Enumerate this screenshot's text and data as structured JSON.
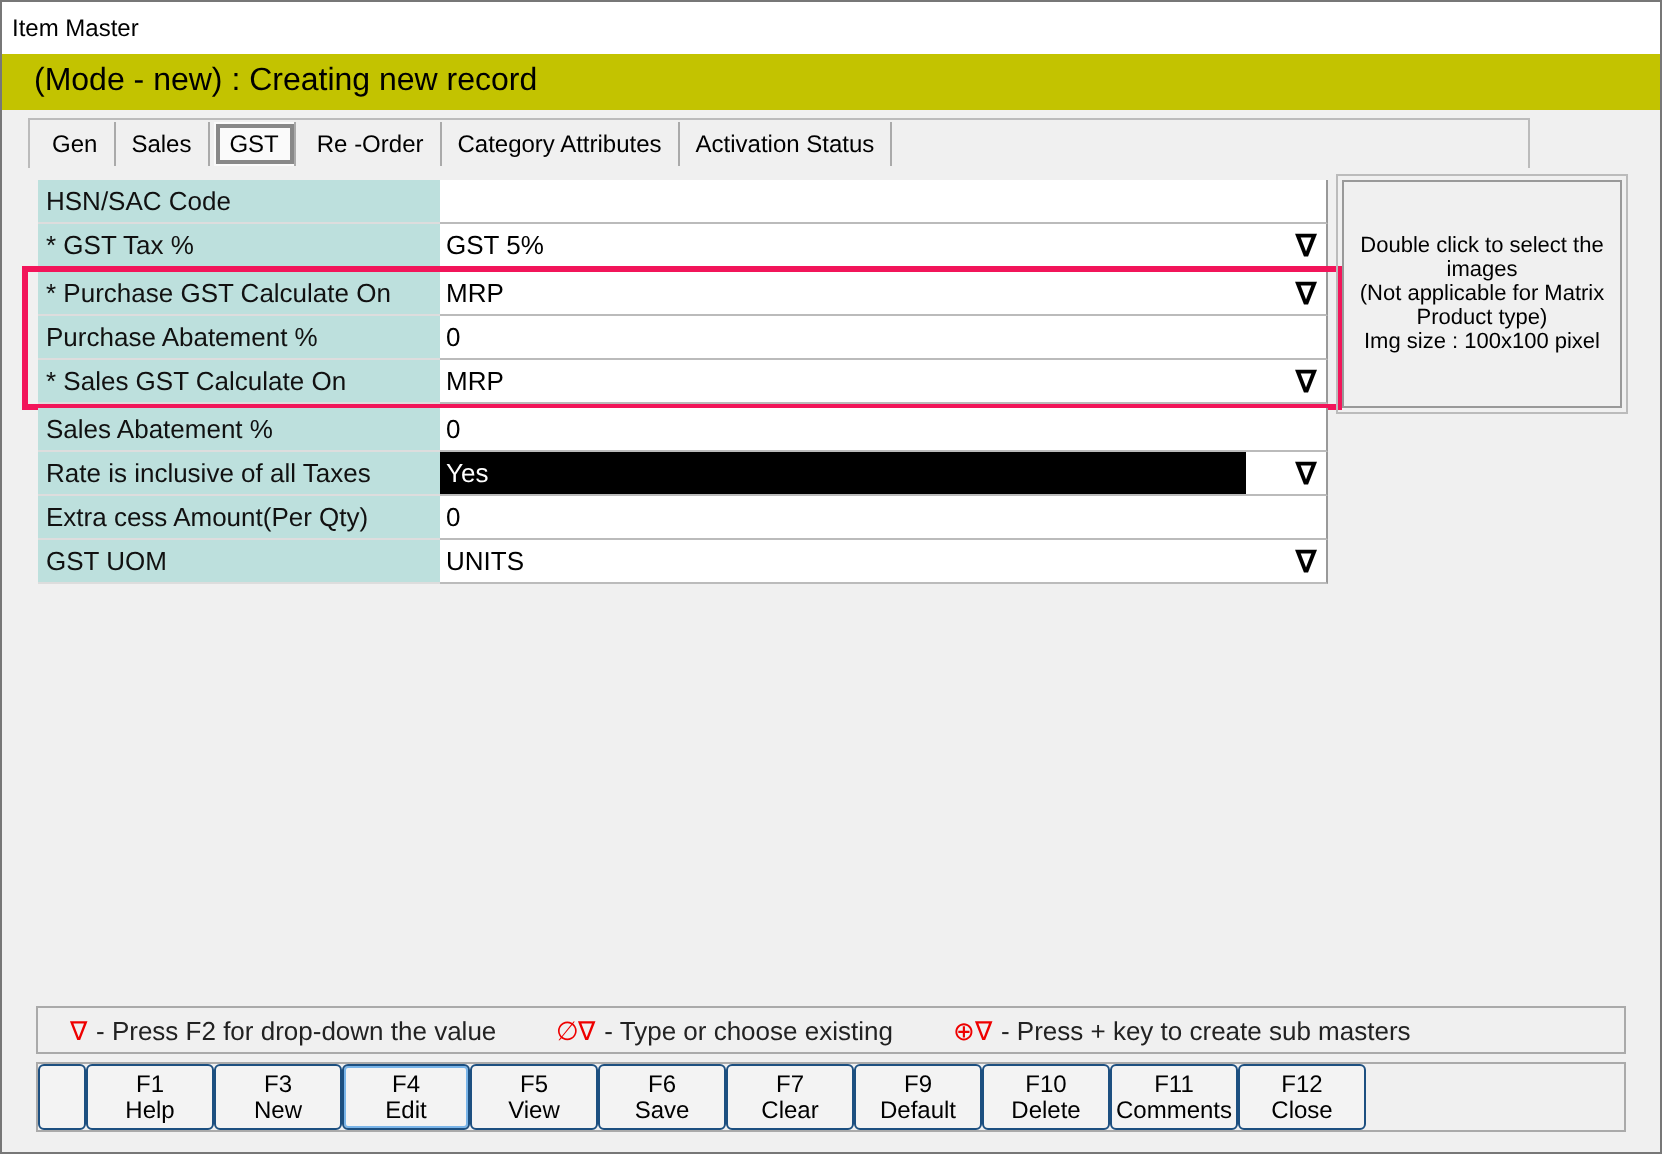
{
  "window": {
    "title": "Item Master"
  },
  "mode_banner": "(Mode - new) : Creating new record",
  "tabs": [
    {
      "label": "Gen",
      "selected": false
    },
    {
      "label": "Sales",
      "selected": false
    },
    {
      "label": "GST",
      "selected": true
    },
    {
      "label": "Re -Order",
      "selected": false
    },
    {
      "label": "Category Attributes",
      "selected": false
    },
    {
      "label": "Activation Status",
      "selected": false
    }
  ],
  "field_groups": [
    {
      "annotated": false,
      "fields": [
        {
          "label": "HSN/SAC Code",
          "kind": "text",
          "highlighted": false
        },
        {
          "label": "* GST Tax %",
          "value": "GST 5%",
          "kind": "dropdown",
          "highlighted": false
        }
      ]
    },
    {
      "annotated": true,
      "fields": [
        {
          "label": "* Purchase GST Calculate On",
          "value": "MRP",
          "kind": "dropdown",
          "highlighted": false
        },
        {
          "label": "Purchase Abatement %",
          "value": "0",
          "kind": "text",
          "highlighted": false
        },
        {
          "label": "* Sales GST Calculate On",
          "value": "MRP",
          "kind": "dropdown",
          "highlighted": false
        }
      ]
    },
    {
      "annotated": false,
      "fields": [
        {
          "label": "Sales Abatement %",
          "value": "0",
          "kind": "text",
          "highlighted": false
        },
        {
          "label": "Rate is inclusive of all Taxes",
          "value": "Yes",
          "kind": "dropdown",
          "highlighted": true
        },
        {
          "label": "Extra cess Amount(Per Qty)",
          "value": "0",
          "kind": "text",
          "highlighted": false
        },
        {
          "label": "GST UOM",
          "value": "UNITS",
          "kind": "dropdown",
          "highlighted": false
        }
      ]
    }
  ],
  "dropdown_symbol": "∇",
  "image_panel": [
    "Double click to select the images",
    "(Not applicable for Matrix Product type)",
    "Img size : 100x100 pixel"
  ],
  "legend": [
    {
      "symbol": "∇",
      "text": "- Press F2 for drop-down the value"
    },
    {
      "symbol": "∅∇",
      "text": "- Type or choose existing"
    },
    {
      "symbol": "⊕∇",
      "text": "- Press + key to create sub masters"
    }
  ],
  "buttons": [
    {
      "focused": false
    },
    {
      "key": "F1",
      "label": "Help",
      "focused": false
    },
    {
      "key": "F3",
      "label": "New",
      "focused": false
    },
    {
      "key": "F4",
      "label": "Edit",
      "focused": true
    },
    {
      "key": "F5",
      "label": "View",
      "focused": false
    },
    {
      "key": "F6",
      "label": "Save",
      "focused": false
    },
    {
      "key": "F7",
      "label": "Clear",
      "focused": false
    },
    {
      "key": "F9",
      "label": "Default",
      "focused": false
    },
    {
      "key": "F10",
      "label": "Delete",
      "focused": false
    },
    {
      "key": "F11",
      "label": "Comments",
      "focused": false
    },
    {
      "key": "F12",
      "label": "Close",
      "focused": false
    }
  ]
}
